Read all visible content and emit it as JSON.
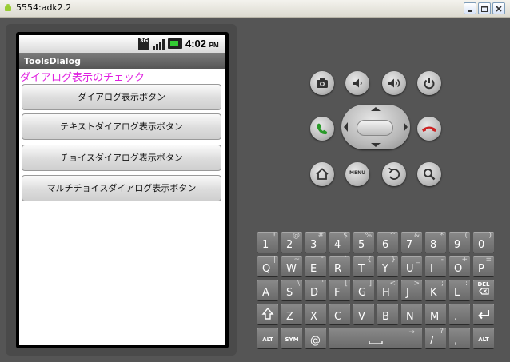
{
  "window": {
    "title": "5554:adk2.2"
  },
  "status_bar": {
    "network": "3G",
    "time": "4:02",
    "ampm": "PM"
  },
  "app": {
    "title": "ToolsDialog",
    "heading": "ダイアログ表示のチェック",
    "buttons": [
      {
        "label": "ダイアログ表示ボタン"
      },
      {
        "label": "テキストダイアログ表示ボタン"
      },
      {
        "label": "チョイスダイアログ表示ボタン"
      },
      {
        "label": "マルチチョイスダイアログ表示ボタン"
      }
    ]
  },
  "controls": {
    "icons": [
      "camera-icon",
      "volume-down-icon",
      "volume-up-icon",
      "power-icon",
      "call-icon",
      "end-call-icon",
      "home-icon",
      "menu-icon",
      "back-icon",
      "search-icon"
    ],
    "menu_label": "MENU"
  },
  "keyboard": {
    "row1": [
      {
        "main": "1",
        "alt": "!"
      },
      {
        "main": "2",
        "alt": "@"
      },
      {
        "main": "3",
        "alt": "#"
      },
      {
        "main": "4",
        "alt": "$"
      },
      {
        "main": "5",
        "alt": "%"
      },
      {
        "main": "6",
        "alt": "^"
      },
      {
        "main": "7",
        "alt": "&"
      },
      {
        "main": "8",
        "alt": "*"
      },
      {
        "main": "9",
        "alt": "("
      },
      {
        "main": "0",
        "alt": ")"
      }
    ],
    "row2": [
      {
        "main": "Q",
        "alt": "|"
      },
      {
        "main": "W",
        "alt": "~"
      },
      {
        "main": "E",
        "alt": "\""
      },
      {
        "main": "R",
        "alt": "`"
      },
      {
        "main": "T",
        "alt": "{"
      },
      {
        "main": "Y",
        "alt": "}"
      },
      {
        "main": "U",
        "alt": "_"
      },
      {
        "main": "I",
        "alt": "-"
      },
      {
        "main": "O",
        "alt": "+"
      },
      {
        "main": "P",
        "alt": "="
      }
    ],
    "row3": [
      {
        "main": "A",
        "alt": ""
      },
      {
        "main": "S",
        "alt": "\\"
      },
      {
        "main": "D",
        "alt": "'"
      },
      {
        "main": "F",
        "alt": "["
      },
      {
        "main": "G",
        "alt": "]"
      },
      {
        "main": "H",
        "alt": "<"
      },
      {
        "main": "J",
        "alt": ">"
      },
      {
        "main": "K",
        "alt": ";"
      },
      {
        "main": "L",
        "alt": ":"
      },
      {
        "main": "",
        "alt": "DEL",
        "icon": "delete-icon"
      }
    ],
    "row4": [
      {
        "main": "",
        "alt": "",
        "icon": "shift-icon"
      },
      {
        "main": "Z",
        "alt": ""
      },
      {
        "main": "X",
        "alt": ""
      },
      {
        "main": "C",
        "alt": ""
      },
      {
        "main": "V",
        "alt": ""
      },
      {
        "main": "B",
        "alt": ""
      },
      {
        "main": "N",
        "alt": ""
      },
      {
        "main": "M",
        "alt": ""
      },
      {
        "main": ".",
        "alt": ""
      },
      {
        "main": "",
        "alt": "",
        "icon": "enter-icon"
      }
    ],
    "row5": {
      "alt_left": "ALT",
      "sym": "SYM",
      "at": "@",
      "space_alt": "→|",
      "slash": "/",
      "slash_alt": "?",
      "comma": ",",
      "alt_right": "ALT"
    }
  },
  "colors": {
    "heading": "#e020e0",
    "call": "#2a9a2a",
    "end_call": "#cc2222",
    "battery": "#33cc33"
  }
}
